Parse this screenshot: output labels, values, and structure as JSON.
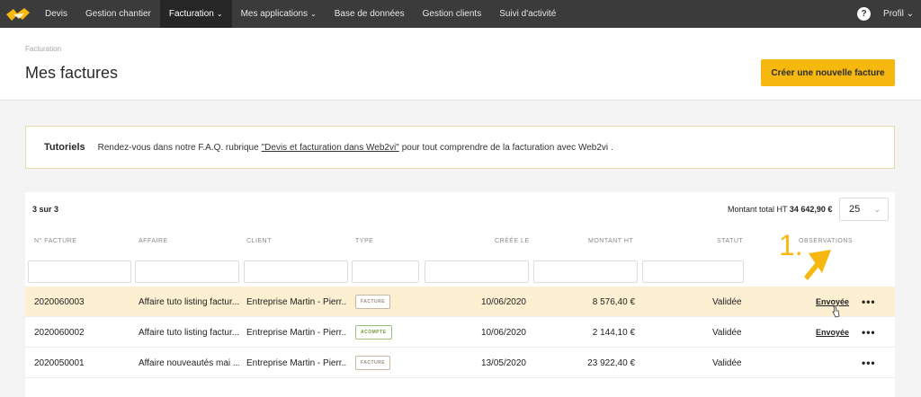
{
  "nav": {
    "items": [
      {
        "label": "Devis",
        "chevron": false,
        "active": false
      },
      {
        "label": "Gestion chantier",
        "chevron": false,
        "active": false
      },
      {
        "label": "Facturation",
        "chevron": true,
        "active": true
      },
      {
        "label": "Mes applications",
        "chevron": true,
        "active": false
      },
      {
        "label": "Base de données",
        "chevron": false,
        "active": false
      },
      {
        "label": "Gestion clients",
        "chevron": false,
        "active": false
      },
      {
        "label": "Suivi d'activité",
        "chevron": false,
        "active": false
      }
    ],
    "help_label": "?",
    "profile_label": "Profil"
  },
  "header": {
    "breadcrumb": "Facturation",
    "title": "Mes factures",
    "create_button": "Créer une nouvelle facture"
  },
  "tutorial": {
    "title": "Tutoriels",
    "text_before": "Rendez-vous dans notre F.A.Q. rubrique",
    "link": "\"Devis et facturation dans Web2vi\"",
    "text_after": "pour tout comprendre de la facturation avec Web2vi ."
  },
  "table": {
    "count": "3 sur 3",
    "total_label": "Montant total HT",
    "total_value": "34 642,90 €",
    "per_page": "25",
    "columns": [
      "N° FACTURE",
      "AFFAIRE",
      "CLIENT",
      "TYPE",
      "CRÉÉE LE",
      "MONTANT HT",
      "STATUT",
      "OBSERVATIONS"
    ],
    "rows": [
      {
        "num": "2020060003",
        "affaire": "Affaire tuto listing factur...",
        "client": "Entreprise Martin - Pierr...",
        "type": "FACTURE",
        "date": "10/06/2020",
        "montant": "8 576,40 €",
        "statut": "Validée",
        "obs": "Envoyée",
        "actions": "•••"
      },
      {
        "num": "2020060002",
        "affaire": "Affaire tuto listing factur...",
        "client": "Entreprise Martin - Pierr...",
        "type": "ACOMPTE",
        "date": "10/06/2020",
        "montant": "2 144,10 €",
        "statut": "Validée",
        "obs": "Envoyée",
        "actions": "•••"
      },
      {
        "num": "2020050001",
        "affaire": "Affaire nouveautés mai ...",
        "client": "Entreprise Martin - Pierr...",
        "type": "FACTURE",
        "date": "13/05/2020",
        "montant": "23 922,40 €",
        "statut": "Validée",
        "obs": "",
        "actions": "•••"
      }
    ]
  },
  "annotation": {
    "number": "1.",
    "color": "#f6b80e"
  },
  "colors": {
    "nav_bg": "#3b3b3b",
    "accent": "#f6b80e",
    "row_highlight": "#fcefd2"
  }
}
